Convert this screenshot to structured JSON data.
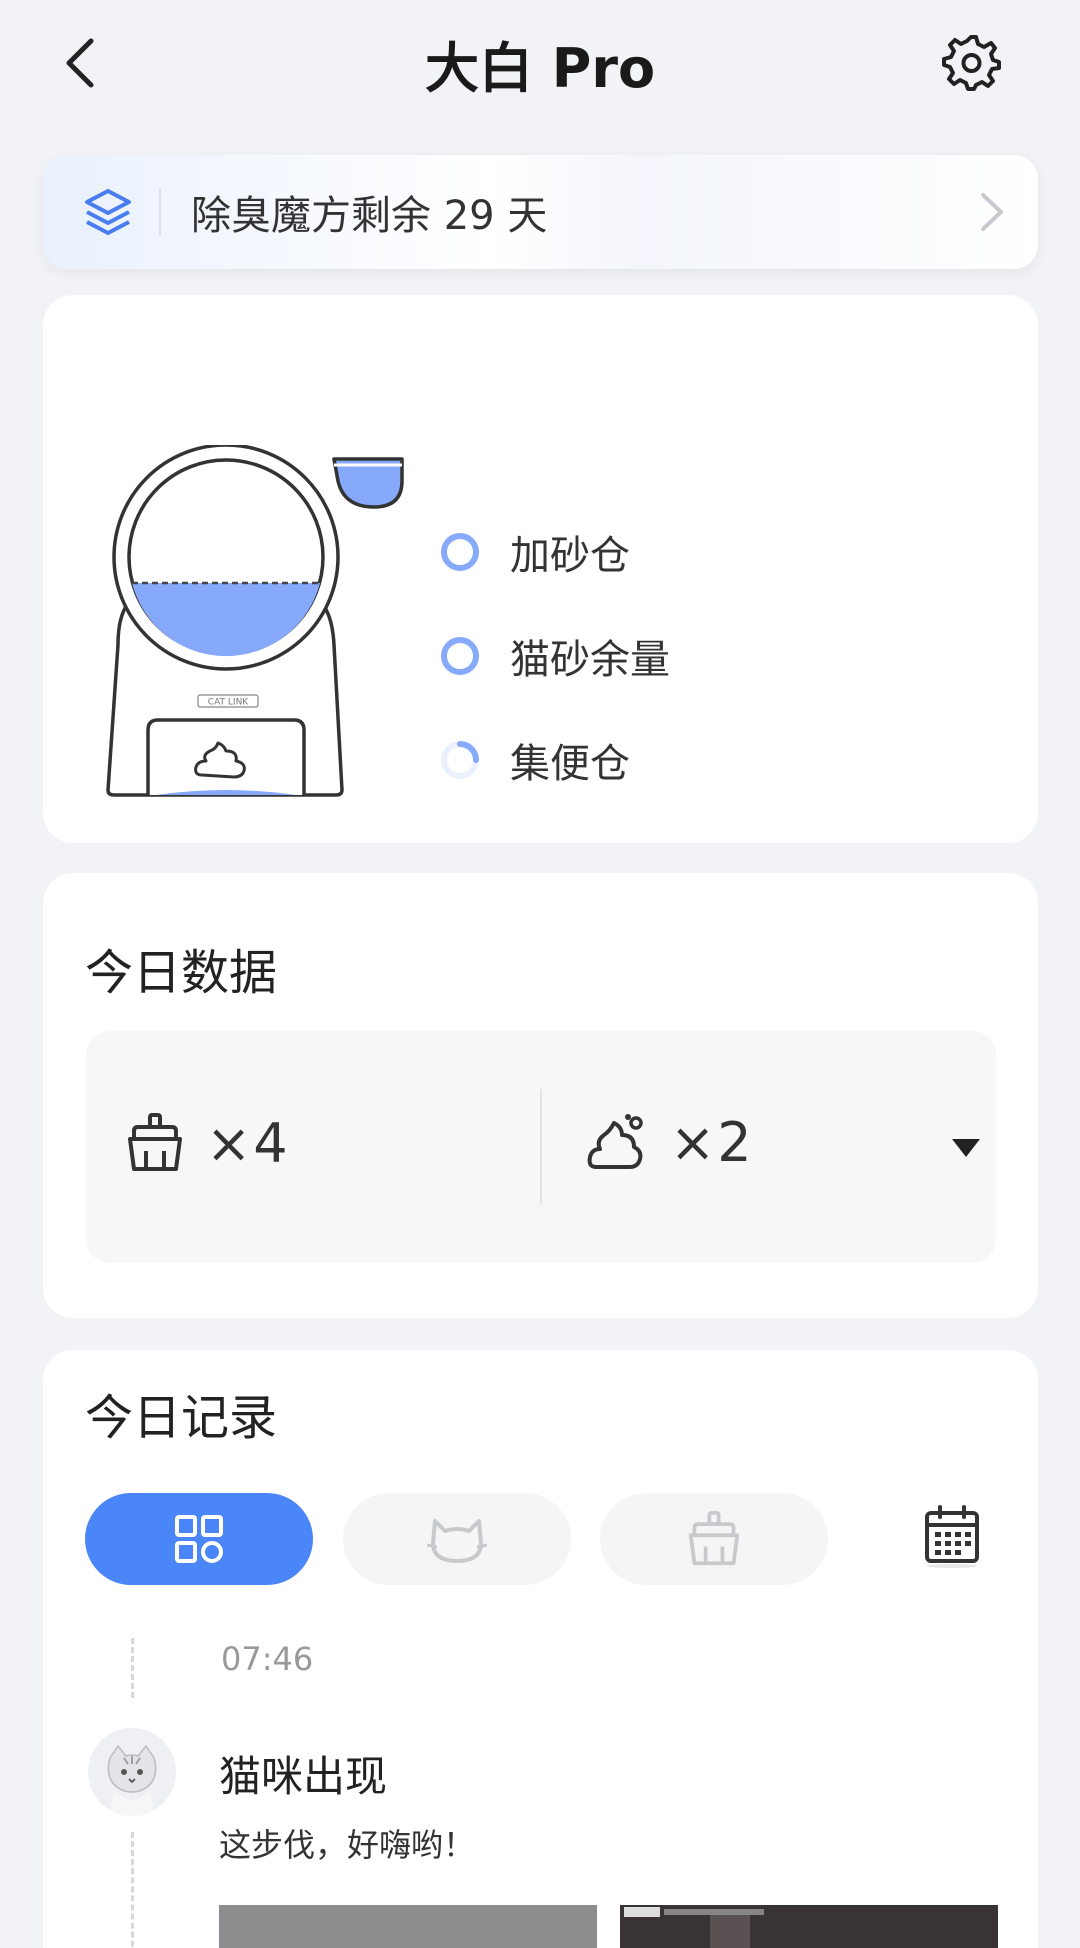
{
  "header": {
    "title": "大白 Pro"
  },
  "banner": {
    "text": "除臭魔方剩余 29 天"
  },
  "device": {
    "brand_mark": "CAT LINK",
    "statuses": [
      {
        "label": "加砂仓",
        "state": "full"
      },
      {
        "label": "猫砂余量",
        "state": "full"
      },
      {
        "label": "集便仓",
        "state": "low"
      }
    ]
  },
  "today_data": {
    "title": "今日数据",
    "clean_count": "×4",
    "visit_count": "×2"
  },
  "today_records": {
    "title": "今日记录",
    "tabs": [
      {
        "name": "all",
        "icon": "grid-icon",
        "active": true
      },
      {
        "name": "cat",
        "icon": "cat-icon",
        "active": false
      },
      {
        "name": "clean",
        "icon": "brush-icon",
        "active": false
      }
    ],
    "entries": [
      {
        "time": "07:46",
        "title": "猫咪出现",
        "description": "这步伐，好嗨哟！"
      }
    ]
  },
  "colors": {
    "accent": "#4a86f7",
    "level_fill": "#86a9fb",
    "background": "#f2f3f7"
  }
}
